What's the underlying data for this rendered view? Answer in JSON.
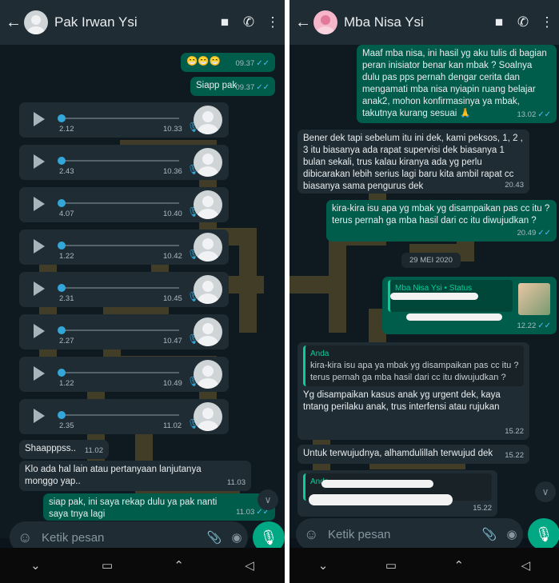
{
  "left": {
    "title": "Pak Irwan Ysi",
    "messages": {
      "m1": {
        "text": "😁😁😁",
        "time": "09.37"
      },
      "m2": {
        "text": "Siapp pak",
        "time": "09.37"
      },
      "voice": [
        {
          "dur": "2.12",
          "time": "10.33"
        },
        {
          "dur": "2.43",
          "time": "10.36"
        },
        {
          "dur": "4.07",
          "time": "10.40"
        },
        {
          "dur": "1.22",
          "time": "10.42"
        },
        {
          "dur": "2.31",
          "time": "10.45"
        },
        {
          "dur": "2.27",
          "time": "10.47"
        },
        {
          "dur": "1.22",
          "time": "10.49"
        },
        {
          "dur": "2.35",
          "time": "11.02"
        }
      ],
      "m3": {
        "text": "Shaapppss..",
        "time": "11.02"
      },
      "m4": {
        "text": "Klo ada hal lain atau pertanyaan lanjutanya monggo yap..",
        "time": "11.03"
      },
      "m5": {
        "text": "siap pak, ini saya rekap dulu ya pak nanti saya tnya lagi",
        "time": "11.03"
      }
    },
    "input_placeholder": "Ketik pesan"
  },
  "right": {
    "title": "Mba Nisa Ysi",
    "messages": {
      "r1": {
        "text": "Maaf mba nisa, ini hasil yg aku tulis di bagian peran inisiator benar kan mbak ? Soalnya dulu pas pps pernah dengar cerita dan mengamati mba nisa nyiapin ruang belajar anak2, mohon konfirmasinya ya mbak, takutnya kurang sesuai 🙏",
        "time": "13.02"
      },
      "r2": {
        "text": "Bener dek tapi sebelum itu ini dek, kami peksos, 1, 2 , 3 itu biasanya ada rapat supervisi dek biasanya 1 bulan sekali, trus kalau kiranya ada yg perlu dibicarakan lebih serius lagi baru kita ambil rapat cc biasanya sama pengurus dek",
        "time": "20.43"
      },
      "r3": {
        "text": "kira-kira isu apa yg mbak yg disampaikan pas cc itu ? terus pernah ga mba hasil dari cc itu diwujudkan ?",
        "time": "20.49"
      },
      "date": "29 MEI 2020",
      "r4": {
        "quote_name": "Mba Nisa Ysi • Status",
        "time": "12.22"
      },
      "r5": {
        "quote_name": "Anda",
        "quote_text": "kira-kira isu apa ya mbak yg disampaikan pas cc itu ? terus pernah ga mba hasil dari cc itu diwujudkan ?",
        "text": "Yg disampaikan kasus anak yg urgent dek, kaya tntang perilaku anak, trus interfensi atau rujukan",
        "time": "15.22"
      },
      "r6": {
        "text": "Untuk terwujudnya, alhamdulillah terwujud dek",
        "time": "15.22"
      },
      "r7": {
        "quote_name": "Anda",
        "time": "15.22"
      }
    },
    "input_placeholder": "Ketik pesan"
  },
  "colors": {
    "header": "#1f2c33",
    "outgoing": "#005c4b",
    "incoming": "#1f2c33",
    "accent": "#00a884",
    "tick": "#53bdeb"
  },
  "icons": [
    "back-arrow-icon",
    "video-call-icon",
    "phone-icon",
    "more-icon",
    "emoji-icon",
    "attach-icon",
    "camera-icon",
    "mic-icon",
    "play-icon",
    "double-check-icon"
  ]
}
